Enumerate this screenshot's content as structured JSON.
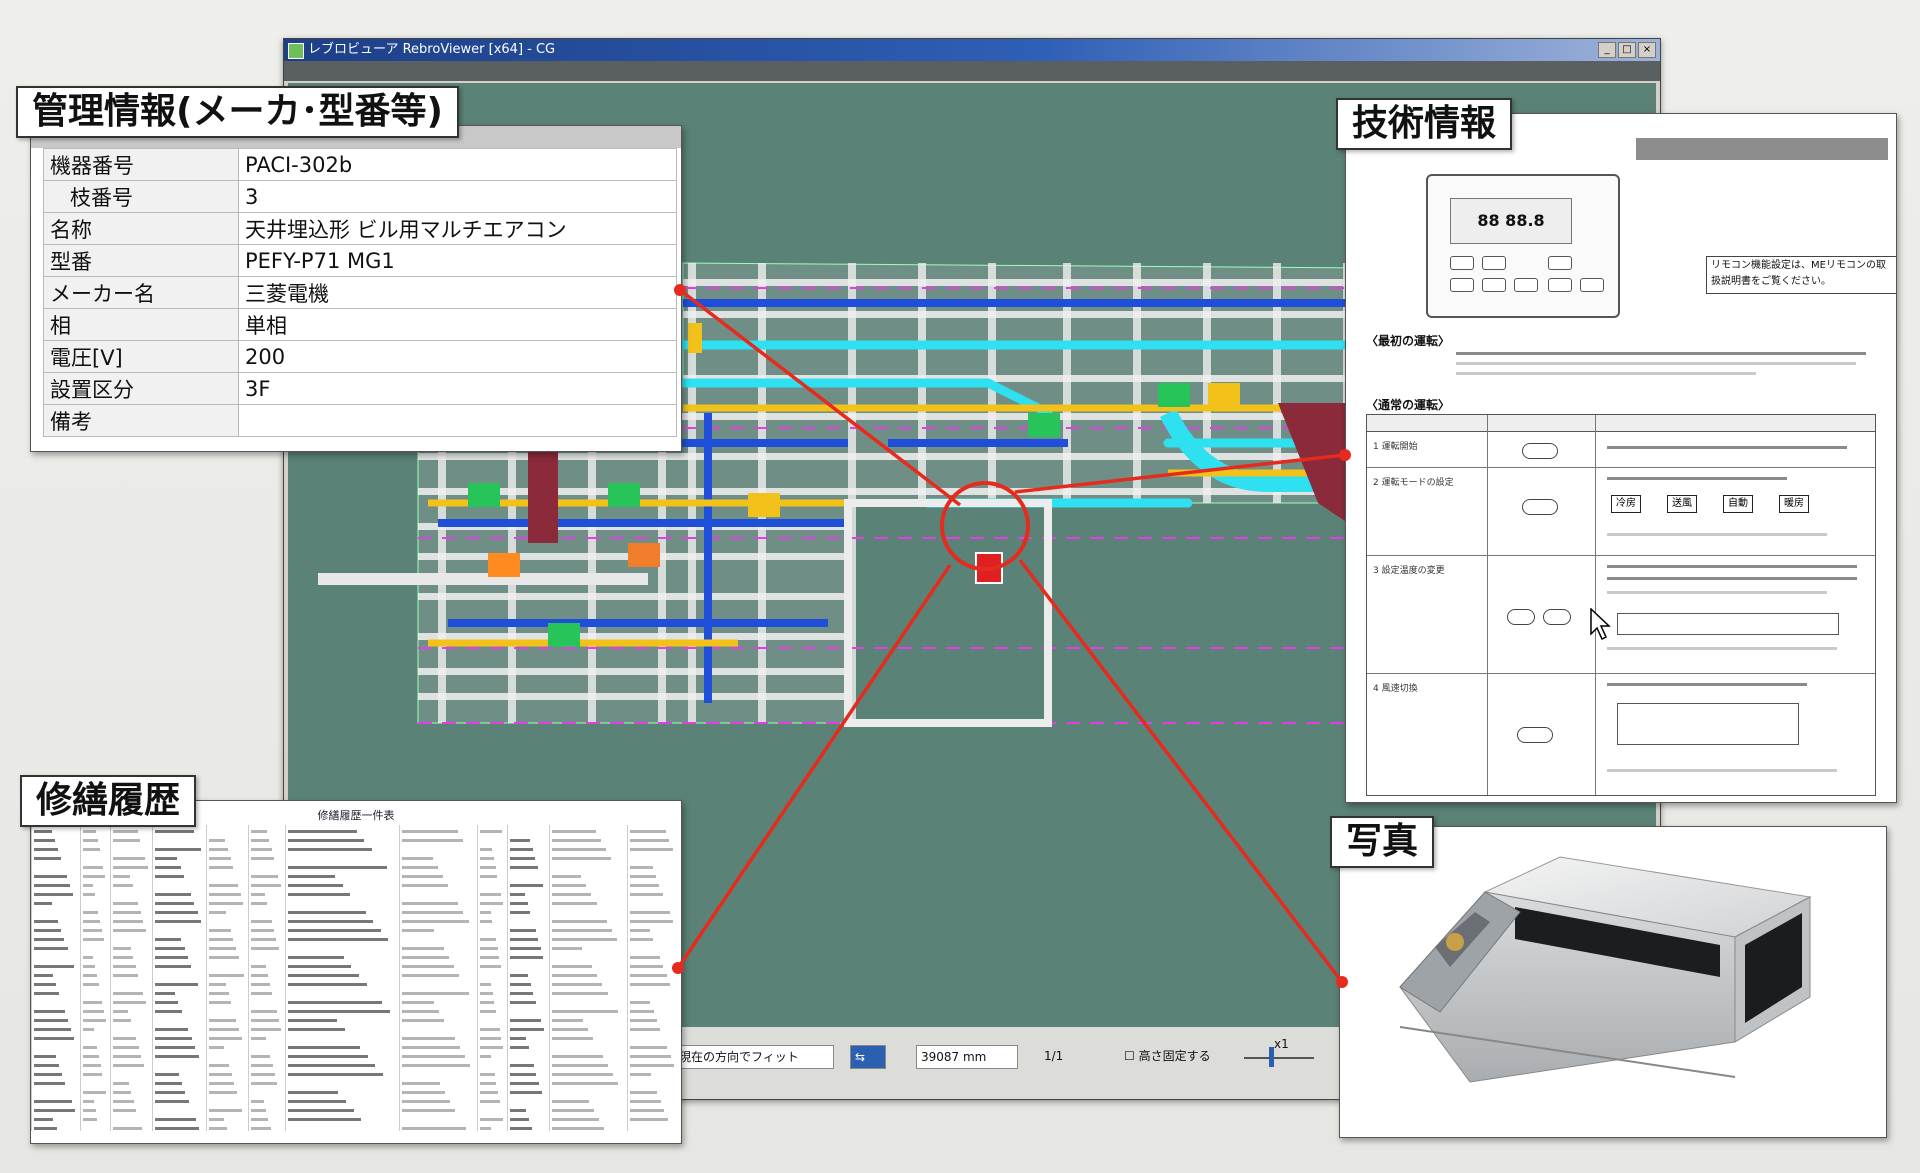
{
  "window": {
    "title": "レブロビューア RebroViewer [x64] - CG",
    "buttons": [
      "_",
      "□",
      "×"
    ]
  },
  "management": {
    "title": "管理情報(メーカ･型番等)",
    "rows": [
      {
        "key": "機器番号",
        "value": "PACI-302b"
      },
      {
        "key": "枝番号",
        "value": "3"
      },
      {
        "key": "名称",
        "value": "天井埋込形 ビル用マルチエアコン"
      },
      {
        "key": "型番",
        "value": "PEFY-P71 MG1"
      },
      {
        "key": "メーカー名",
        "value": "三菱電機"
      },
      {
        "key": "相",
        "value": "単相"
      },
      {
        "key": "電圧[V]",
        "value": "200"
      },
      {
        "key": "設置区分",
        "value": "3F"
      },
      {
        "key": "備考",
        "value": ""
      }
    ]
  },
  "repair": {
    "title": "修繕履歴",
    "header": "修繕履歴一件表"
  },
  "tech": {
    "title": "技術情報",
    "remote_display": "88 88.8",
    "note": "リモコン機能設定は、MEリモコンの取扱説明書をご覧ください。",
    "section1": "〈最初の運転〉",
    "section2": "〈通常の運転〉",
    "rows": [
      "1 運転開始",
      "2 運転モードの設定",
      "3 設定温度の変更",
      "4 風速切換"
    ],
    "flow": [
      "冷房",
      "送風",
      "自動",
      "暖房"
    ]
  },
  "photo": {
    "title": "写真"
  },
  "statusbar": {
    "view_select": "現在の方向でフィット",
    "distance": "39087 mm",
    "scale": "1/1",
    "height_fix": "高さ固定する",
    "zoom": "x1"
  },
  "colors": {
    "viewport_bg": "#5b8277",
    "callout_line": "#e52a1e",
    "pipe_cyan": "#2ee0f0",
    "pipe_blue": "#1f4fd8",
    "duct_yellow": "#f2c21a",
    "frame_magenta": "#e040e0",
    "duct_maroon": "#8a2a3a"
  }
}
